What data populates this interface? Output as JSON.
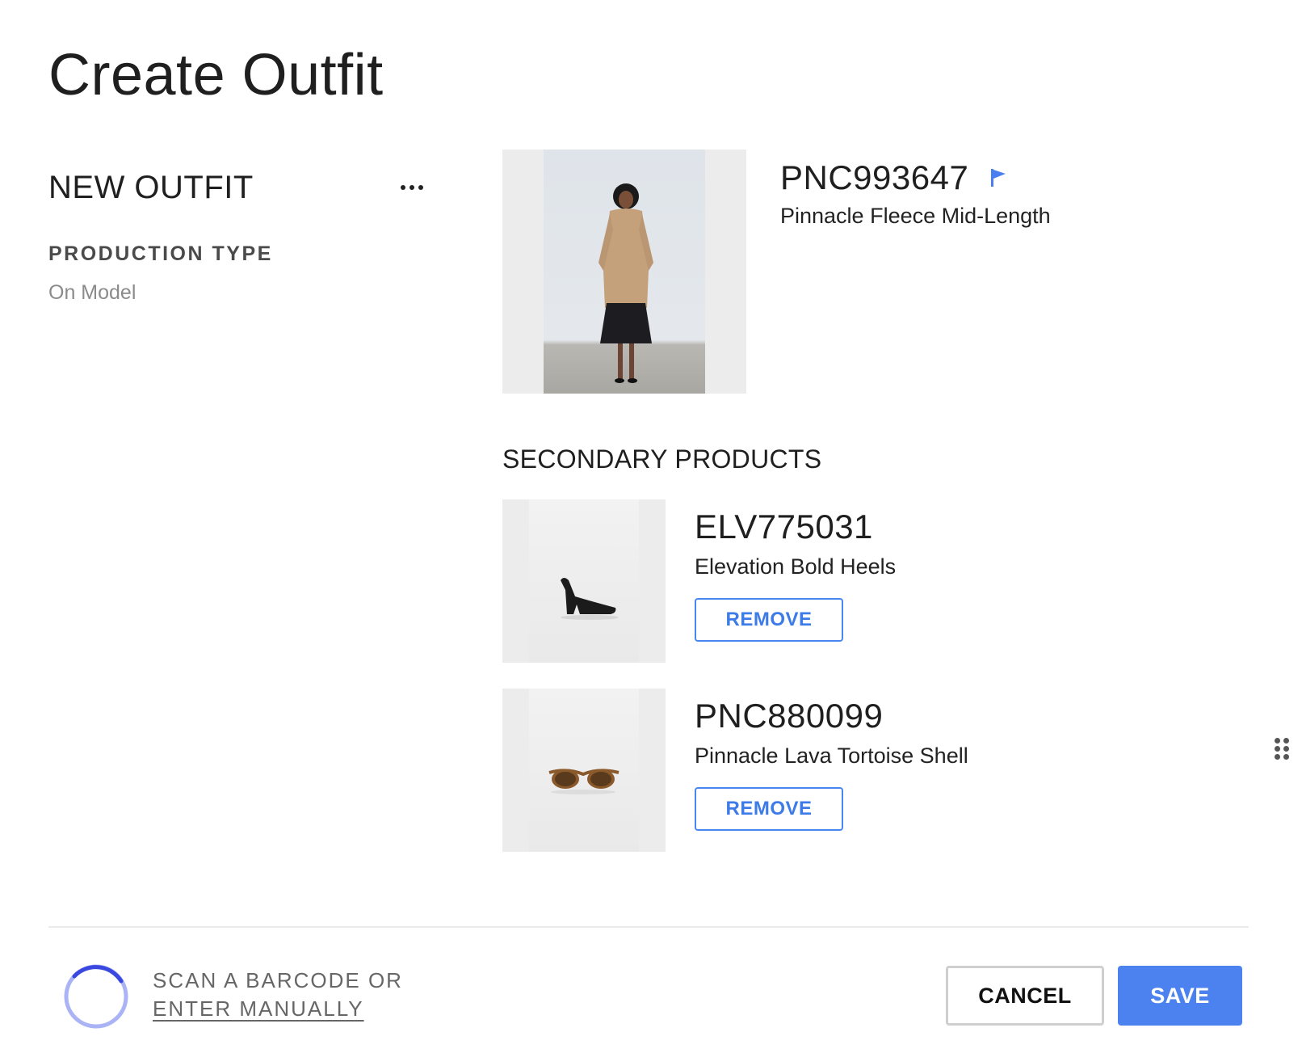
{
  "page": {
    "title": "Create Outfit"
  },
  "outfit": {
    "name": "NEW OUTFIT",
    "production_type_label": "PRODUCTION TYPE",
    "production_type_value": "On Model"
  },
  "primary_product": {
    "sku": "PNC993647",
    "name": "Pinnacle Fleece Mid-Length",
    "flag_color": "#4a7ff0"
  },
  "secondary": {
    "title": "SECONDARY PRODUCTS",
    "items": [
      {
        "sku": "ELV775031",
        "name": "Elevation Bold Heels",
        "remove_label": "REMOVE"
      },
      {
        "sku": "PNC880099",
        "name": "Pinnacle Lava Tortoise Shell",
        "remove_label": "REMOVE"
      }
    ]
  },
  "footer": {
    "scan_text": "SCAN A BARCODE OR",
    "enter_manually": "ENTER MANUALLY",
    "cancel_label": "CANCEL",
    "save_label": "SAVE"
  },
  "colors": {
    "accent": "#4b82ef",
    "spinner_track": "#a9b3f5",
    "spinner_arc": "#3a48e0"
  },
  "icons": [
    "more-icon",
    "flag-icon",
    "drag-handle-icon",
    "loading-spinner-icon"
  ]
}
